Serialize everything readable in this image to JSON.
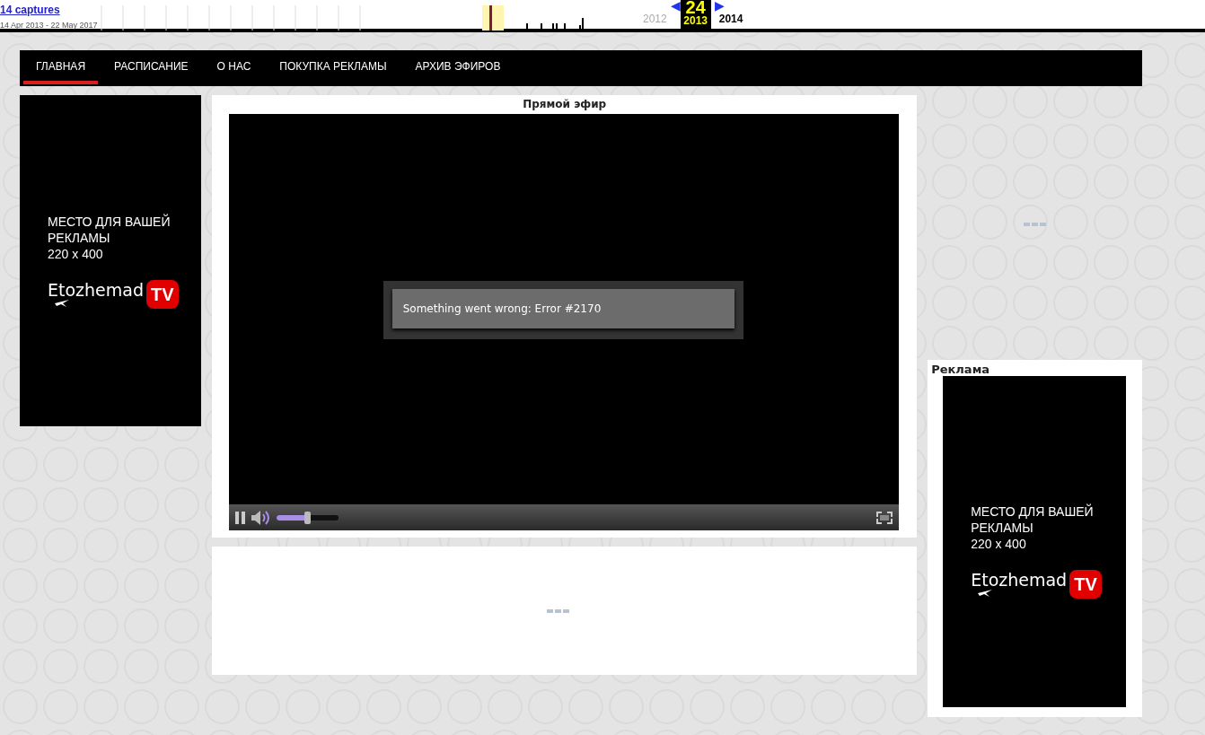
{
  "wayback": {
    "captures_link": "14 captures",
    "date_range": "14 Apr 2013 - 22 May 2017",
    "day": "24",
    "years": [
      {
        "label": "2012",
        "selected": false
      },
      {
        "label": "2013",
        "selected": true
      },
      {
        "label": "2014",
        "selected": false
      }
    ],
    "prev_arrow": "◀",
    "next_arrow": "▶"
  },
  "nav": [
    {
      "label": "ГЛАВНАЯ",
      "selected": true
    },
    {
      "label": "РАСПИСАНИЕ",
      "selected": false
    },
    {
      "label": "О НАС",
      "selected": false
    },
    {
      "label": "ПОКУПКА РЕКЛАМЫ",
      "selected": false
    },
    {
      "label": "АРХИВ ЭФИРОВ",
      "selected": false
    }
  ],
  "left_ad": {
    "lines": [
      "МЕСТО ДЛЯ ВАШЕЙ",
      "РЕКЛАМЫ",
      "220 x 400"
    ],
    "logo_text": "Etozhemad",
    "logo_badge": "TV"
  },
  "player": {
    "title": "Прямой эфир",
    "error": "Something went wrong: Error #2170",
    "volume": {
      "level": 0.49
    }
  },
  "right_ad": {
    "title": "Реклама",
    "lines": [
      "МЕСТО ДЛЯ ВАШЕЙ",
      "РЕКЛАМЫ",
      "220 x 400"
    ],
    "logo_text": "Etozhemad",
    "logo_badge": "TV"
  }
}
